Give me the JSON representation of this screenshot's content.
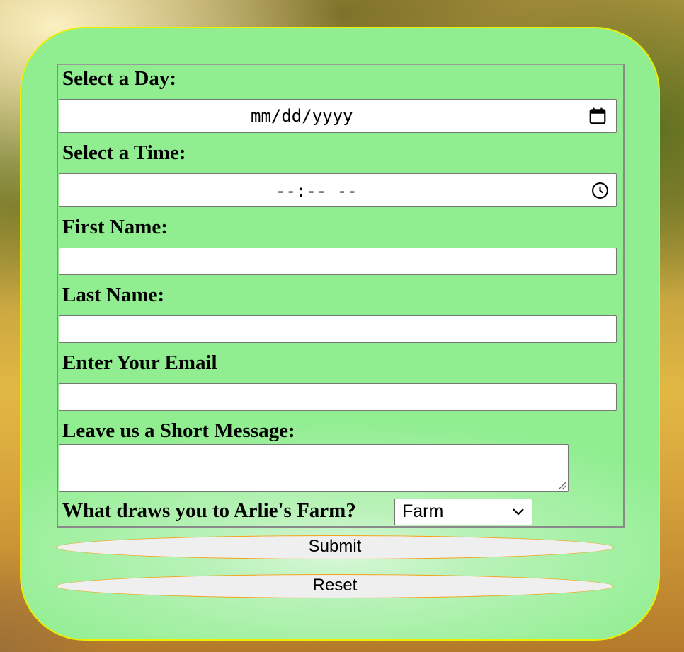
{
  "form": {
    "day": {
      "label": "Select a Day:",
      "placeholder": "mm/dd/yyyy"
    },
    "time": {
      "label": "Select a Time:",
      "placeholder": "--:-- --"
    },
    "first_name": {
      "label": "First Name:"
    },
    "last_name": {
      "label": "Last Name:"
    },
    "email": {
      "label": "Enter Your Email"
    },
    "message": {
      "label": "Leave us a Short Message:"
    },
    "interest": {
      "label": "What draws you to Arlie's Farm?",
      "selected": "Farm"
    },
    "submit_label": "Submit",
    "reset_label": "Reset"
  },
  "icons": {
    "calendar": "calendar-icon",
    "clock": "clock-icon",
    "chevron": "chevron-down-icon",
    "resize": "resize-handle-icon"
  },
  "colors": {
    "panel_bg": "#90ee90",
    "panel_border": "#ecf000",
    "button_border": "#f3a21a",
    "button_bg": "#efefef"
  }
}
